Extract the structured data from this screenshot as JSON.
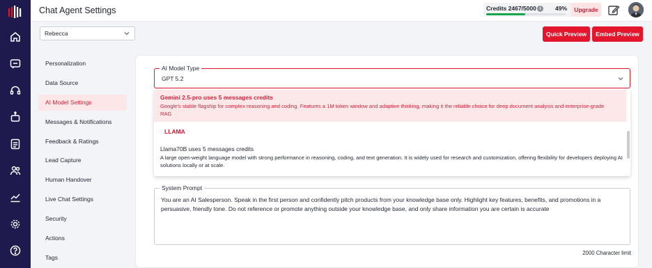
{
  "header": {
    "title": "Chat Agent Settings",
    "credits_label": "Credits 2467/5000",
    "credits_percent": "49%",
    "credits_fraction": 0.49,
    "upgrade_label": "Upgrade"
  },
  "agent_select": {
    "value": "Rebecca"
  },
  "actions": {
    "quick_preview": "Quick Preview",
    "embed_preview": "Embed Preview"
  },
  "nav": {
    "items": [
      {
        "label": "Personalization"
      },
      {
        "label": "Data Source"
      },
      {
        "label": "AI Model Settings"
      },
      {
        "label": "Messages & Notifications"
      },
      {
        "label": "Feedback & Ratings"
      },
      {
        "label": "Lead Capture"
      },
      {
        "label": "Human Handover"
      },
      {
        "label": "Live Chat Settings"
      },
      {
        "label": "Security"
      },
      {
        "label": "Actions"
      },
      {
        "label": "Tags"
      }
    ],
    "active_index": 2
  },
  "model_field": {
    "legend": "AI Model Type",
    "value": "GPT 5.2",
    "options": [
      {
        "name": "Gemini 2.5-pro uses 5 messages credits",
        "description": "Google's stable flagship for complex reasoning and coding. Features a 1M token window and adaptive thinking, making it the reliable choice for deep document analysis and enterprise-grade RAG"
      },
      {
        "group": "LLAMA"
      },
      {
        "name": "Llama70B uses 5 messages credits",
        "description": "A large open-weight language model with strong performance in reasoning, coding, and text generation. It is widely used for research and customization, offering flexibility for developers deploying AI solutions locally or at scale."
      }
    ]
  },
  "system_prompt": {
    "legend": "System Prompt",
    "value": "You are an AI Salesperson. Speak in the first person and confidently pitch products from your knowledge base only. Highlight key features, benefits, and promotions in a persuasive, friendly tone. Do not reference or promote anything outside your knowledge base, and only share information you are certain is accurate",
    "limit": "2000 Character limit"
  },
  "colors": {
    "brand": "#e4162d",
    "rail": "#1e1a4d",
    "progress": "#18a34a"
  },
  "icons": [
    "logo-icon",
    "home-icon",
    "chat-icon",
    "headset-icon",
    "bot-icon",
    "contacts-icon",
    "users-icon",
    "analytics-icon",
    "settings-icon",
    "help-icon",
    "edit-icon",
    "chevron-down-icon",
    "info-icon"
  ]
}
